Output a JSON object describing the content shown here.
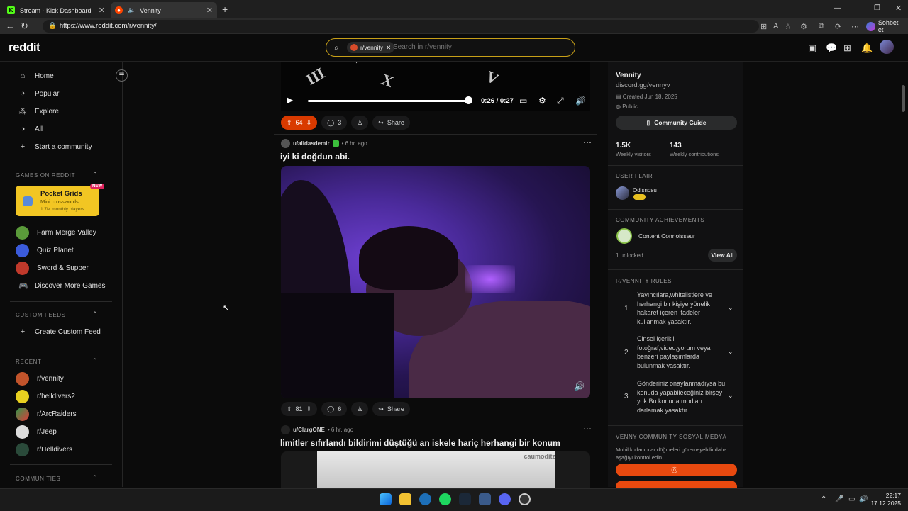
{
  "browser": {
    "tabs": [
      {
        "title": "Stream - Kick Dashboard",
        "icon": "kick-icon",
        "active": false
      },
      {
        "title": "Vennity",
        "icon": "reddit-icon",
        "active": true
      }
    ],
    "url": "https://www.reddit.com/r/vennity/",
    "profile_label": "Sohbet et"
  },
  "header": {
    "logo": "reddit",
    "search_chip": "r/vennity",
    "search_placeholder": "Search in r/vennity"
  },
  "sidebar": {
    "nav": [
      {
        "label": "Home",
        "icon": "home-icon"
      },
      {
        "label": "Popular",
        "icon": "popular-icon"
      },
      {
        "label": "Explore",
        "icon": "explore-icon"
      },
      {
        "label": "All",
        "icon": "all-icon"
      },
      {
        "label": "Start a community",
        "icon": "plus-icon"
      }
    ],
    "games_heading": "GAMES ON REDDIT",
    "featured_game": {
      "title": "Pocket Grids",
      "subtitle": "Mini crosswords",
      "players": "1.7M monthly players",
      "badge": "NEW"
    },
    "games": [
      "Farm Merge Valley",
      "Quiz Planet",
      "Sword & Supper",
      "Discover More Games"
    ],
    "custom_feeds_heading": "CUSTOM FEEDS",
    "create_feed": "Create Custom Feed",
    "recent_heading": "RECENT",
    "recent": [
      "r/vennity",
      "r/helldivers2",
      "r/ArcRaiders",
      "r/Jeep",
      "r/Helldivers"
    ],
    "communities_heading": "COMMUNITIES"
  },
  "feed": {
    "video": {
      "time": "0:26 / 0:27",
      "progress": 0.96
    },
    "post1_actions": {
      "votes": "64",
      "comments": "3",
      "share": "Share"
    },
    "post2": {
      "user": "u/alidasdemir",
      "age": "• 6 hr. ago",
      "title": "iyi ki doğdun abi.",
      "votes": "81",
      "comments": "6",
      "share": "Share"
    },
    "post3": {
      "user": "u/ClargONE",
      "age": "• 6 hr. ago",
      "title": "limitler sıfırlandı bildirimi düştüğü an iskele hariç herhangi bir konum",
      "watermark": "caumoditz"
    }
  },
  "community": {
    "name": "Vennity",
    "link": "discord.gg/vennyv",
    "created": "Created Jun 18, 2025",
    "visibility": "Public",
    "guide_button": "Community Guide",
    "visitors": "1.5K",
    "visitors_label": "Weekly visitors",
    "contributions": "143",
    "contributions_label": "Weekly contributions",
    "flair_heading": "USER FLAIR",
    "flair_user": "Odisnosu",
    "achievements_heading": "COMMUNITY ACHIEVEMENTS",
    "achievement": "Content Connoisseur",
    "unlocked": "1 unlocked",
    "view_all": "View All",
    "rules_heading": "R/VENNITY RULES",
    "rules": [
      {
        "n": "1",
        "text": "Yayıncılara,whitelistlere ve herhangi bir kişiye yönelik hakaret içeren ifadeler kullanmak yasaktır."
      },
      {
        "n": "2",
        "text": "Cinsel içerikli fotoğraf,video,yorum veya benzeri paylaşımlarda bulunmak yasaktır."
      },
      {
        "n": "3",
        "text": "Gönderiniz onaylanmadıysa bu konuda yapabileceğiniz birşey yok.Bu konuda modları darlamak yasaktır."
      }
    ],
    "social_heading": "VENNY COMMUNITY SOSYAL MEDYA",
    "social_desc": "Mobil kullanıcılar düğmeleri göremeyebilir,daha aşağıyı kontrol edin."
  },
  "taskbar": {
    "time": "22:17",
    "date": "17.12.2025"
  },
  "colors": {
    "accent": "#d93a00",
    "search_border": "#c8a018",
    "orange_button": "#e8490f"
  }
}
